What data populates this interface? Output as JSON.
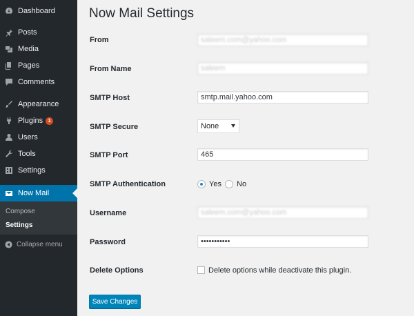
{
  "sidebar": {
    "items": [
      {
        "label": "Dashboard",
        "icon": "dashboard-icon"
      },
      {
        "label": "Posts",
        "icon": "pin-icon"
      },
      {
        "label": "Media",
        "icon": "media-icon"
      },
      {
        "label": "Pages",
        "icon": "pages-icon"
      },
      {
        "label": "Comments",
        "icon": "comment-icon"
      },
      {
        "label": "Appearance",
        "icon": "brush-icon"
      },
      {
        "label": "Plugins",
        "icon": "plugin-icon",
        "badge": "1"
      },
      {
        "label": "Users",
        "icon": "user-icon"
      },
      {
        "label": "Tools",
        "icon": "wrench-icon"
      },
      {
        "label": "Settings",
        "icon": "settings-icon"
      },
      {
        "label": "Now Mail",
        "icon": "mail-icon",
        "active": true
      }
    ],
    "submenu": [
      "Compose",
      "Settings"
    ],
    "collapse_label": "Collapse menu"
  },
  "page": {
    "title": "Now Mail Settings"
  },
  "form": {
    "from": {
      "label": "From",
      "value": "saleem.com@yahoo.com"
    },
    "from_name": {
      "label": "From Name",
      "value": "saleem"
    },
    "smtp_host": {
      "label": "SMTP Host",
      "value": "smtp.mail.yahoo.com"
    },
    "smtp_secure": {
      "label": "SMTP Secure",
      "value": "None"
    },
    "smtp_port": {
      "label": "SMTP Port",
      "value": "465"
    },
    "smtp_auth": {
      "label": "SMTP Authentication",
      "options": [
        "Yes",
        "No"
      ],
      "selected": "Yes"
    },
    "username": {
      "label": "Username",
      "value": "saleem.com@yahoo.com"
    },
    "password": {
      "label": "Password",
      "value": "•••••••••••"
    },
    "delete_options": {
      "label": "Delete Options",
      "checkbox_label": "Delete options while deactivate this plugin.",
      "checked": false
    },
    "save_label": "Save Changes"
  },
  "colors": {
    "sidebar_bg": "#23282d",
    "accent": "#0073aa",
    "button": "#0085ba",
    "badge": "#d54e21"
  }
}
